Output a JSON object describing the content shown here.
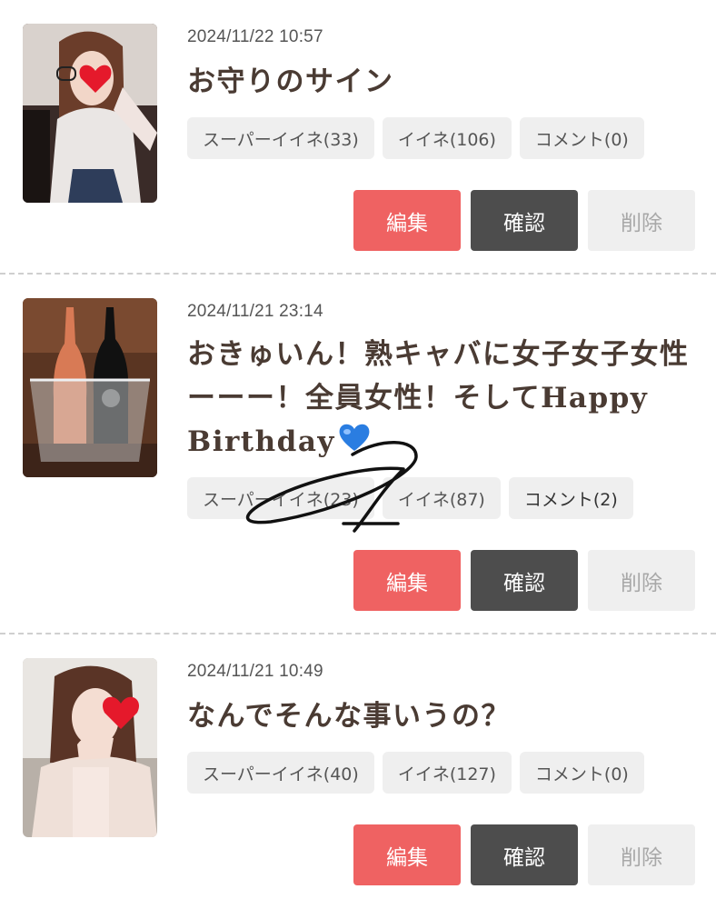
{
  "posts": [
    {
      "date": "2024/11/22 10:57",
      "title": "お守りのサイン",
      "tags": [
        "スーパーイイネ(33)",
        "イイネ(106)",
        "コメント(0)"
      ],
      "buttons": {
        "edit": "編集",
        "confirm": "確認",
        "delete": "削除"
      }
    },
    {
      "date": "2024/11/21 23:14",
      "title": "おきゅいん！熟キャバに女子女子女性ーーー！全員女性！そしてHappy Birthday",
      "title_emoji": "blue-heart-icon",
      "tags": [
        "スーパーイイネ(23)",
        "イイネ(87)",
        "コメント(2)"
      ],
      "buttons": {
        "edit": "編集",
        "confirm": "確認",
        "delete": "削除"
      }
    },
    {
      "date": "2024/11/21 10:49",
      "title": "なんでそんな事いうの？",
      "tags": [
        "スーパーイイネ(40)",
        "イイネ(127)",
        "コメント(0)"
      ],
      "buttons": {
        "edit": "編集",
        "confirm": "確認",
        "delete": "削除"
      }
    }
  ],
  "colors": {
    "edit": "#ef6262",
    "confirm": "#4d4d4d",
    "delete": "#efefef",
    "tag_bg": "#efefef",
    "title": "#4a3b33",
    "heart_red": "#e5192b",
    "heart_blue": "#2a7de1"
  }
}
